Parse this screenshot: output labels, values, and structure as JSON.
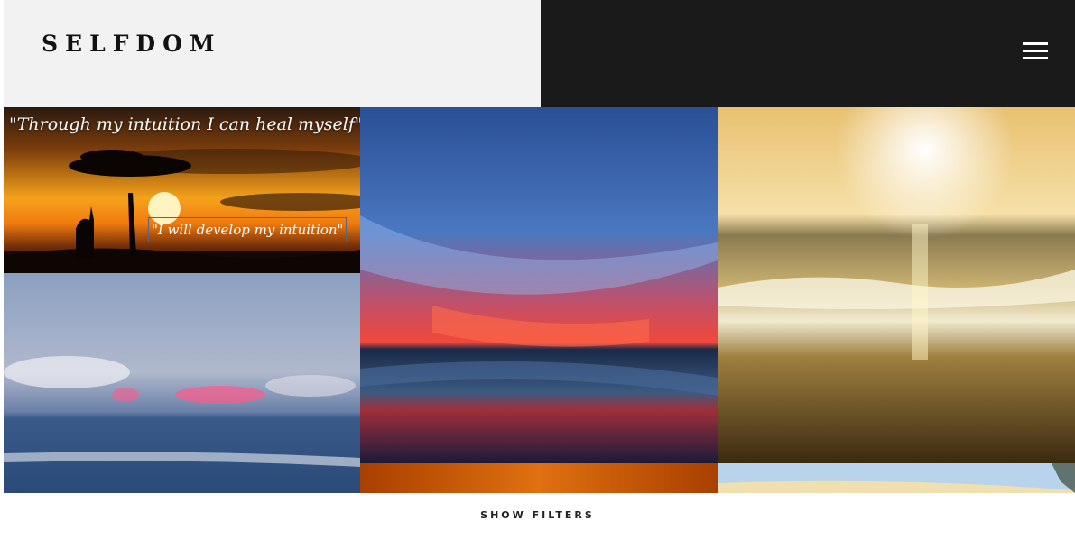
{
  "header": {
    "logo": "SELFDOM",
    "menu_icon": "hamburger-menu-icon"
  },
  "gallery": {
    "tiles": [
      {
        "id": "sunset-savanna",
        "quote_top": "\"Through my intuition I can heal myself\"",
        "quote_box": "\"I will develop my intuition\""
      },
      {
        "id": "blue-red-sky-sea"
      },
      {
        "id": "golden-beach-waves"
      },
      {
        "id": "pink-cloud-sea"
      },
      {
        "id": "orange-partial"
      },
      {
        "id": "sky-partial"
      }
    ]
  },
  "footer": {
    "show_filters": "SHOW FILTERS"
  }
}
